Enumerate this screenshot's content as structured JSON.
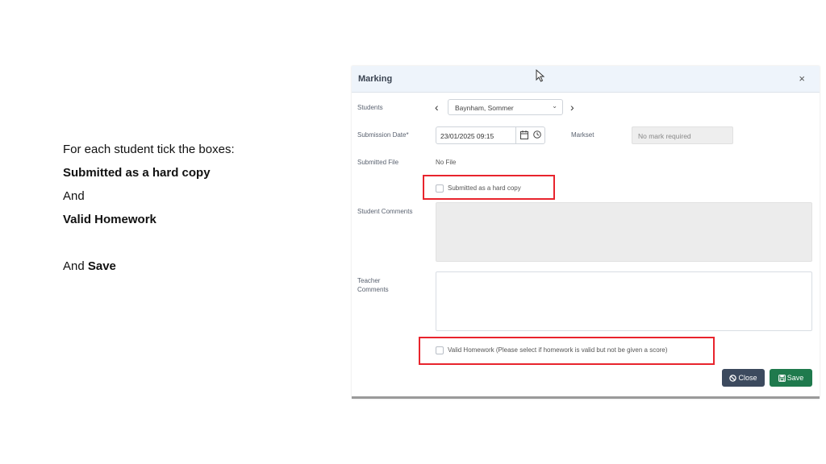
{
  "instructions": {
    "line1": "For each student tick the boxes:",
    "line2": "Submitted as a hard copy",
    "line3": "And",
    "line4": "Valid Homework",
    "line5_prefix": "And ",
    "line5_bold": "Save"
  },
  "modal": {
    "title": "Marking",
    "close_glyph": "×",
    "fields": {
      "students_label": "Students",
      "student_selected": "Baynham, Sommer",
      "submission_date_label": "Submission Date*",
      "submission_date_value": "23/01/2025 09:15",
      "markset_label": "Markset",
      "markset_value": "No mark required",
      "submitted_file_label": "Submitted File",
      "submitted_file_value": "No File",
      "hard_copy_label": "Submitted as a hard copy",
      "hard_copy_checked": false,
      "student_comments_label": "Student Comments",
      "teacher_comments_label_1": "Teacher",
      "teacher_comments_label_2": "Comments",
      "valid_homework_label": "Valid Homework (Please select if homework is valid but not be given a score)",
      "valid_homework_checked": false
    },
    "buttons": {
      "close_label": "Close",
      "save_label": "Save"
    },
    "icons": {
      "prev": "‹",
      "next": "›",
      "dropdown": "⌄"
    },
    "colors": {
      "highlight": "#e8242d",
      "save_button": "#1f7a4d",
      "close_button": "#3c4a5e",
      "header_bg": "#eef4fb"
    }
  }
}
